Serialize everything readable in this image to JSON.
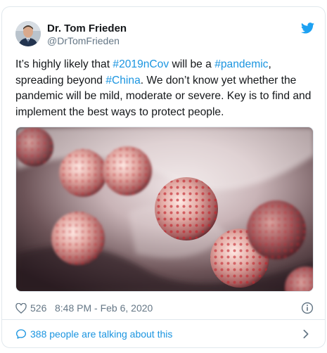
{
  "tweet": {
    "author": {
      "display_name": "Dr. Tom Frieden",
      "handle": "@DrTomFrieden"
    },
    "brand_icon": "twitter-bird-icon",
    "text_parts": [
      "It’s highly likely that ",
      "#2019nCov",
      " will be a ",
      "#pandemic",
      ", spreading beyond ",
      "#China",
      ". We don’t know yet whether the pandemic will be mild, moderate or severe. Key is to find and implement the best ways to protect people."
    ],
    "media": {
      "type": "photo"
    },
    "likes": "526",
    "timestamp": "8:48 PM - Feb 6, 2020",
    "footer": {
      "label": "388 people are talking about this"
    }
  },
  "colors": {
    "link": "#1b95e0",
    "secondary_text": "#657786",
    "border": "#e1e8ed",
    "brand": "#1da1f2"
  }
}
